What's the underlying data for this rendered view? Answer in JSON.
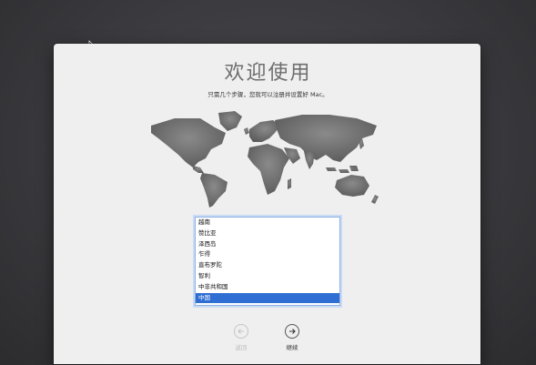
{
  "welcome": {
    "title": "欢迎使用",
    "subtitle": "只需几个步骤，您就可以注册并设置好 Mac。"
  },
  "country_list": {
    "items": [
      "越南",
      "赞比亚",
      "泽西岛",
      "乍得",
      "直布罗陀",
      "智利",
      "中非共和国",
      "中国"
    ],
    "selected": "中国"
  },
  "navigation": {
    "back_label": "返回",
    "continue_label": "继续"
  },
  "colors": {
    "selection": "#2f6ed3",
    "window_background": "#efefef"
  },
  "icons": {
    "back": "arrow-left-circle-icon",
    "continue": "arrow-right-circle-icon",
    "cursor": "mouse-pointer-icon"
  }
}
